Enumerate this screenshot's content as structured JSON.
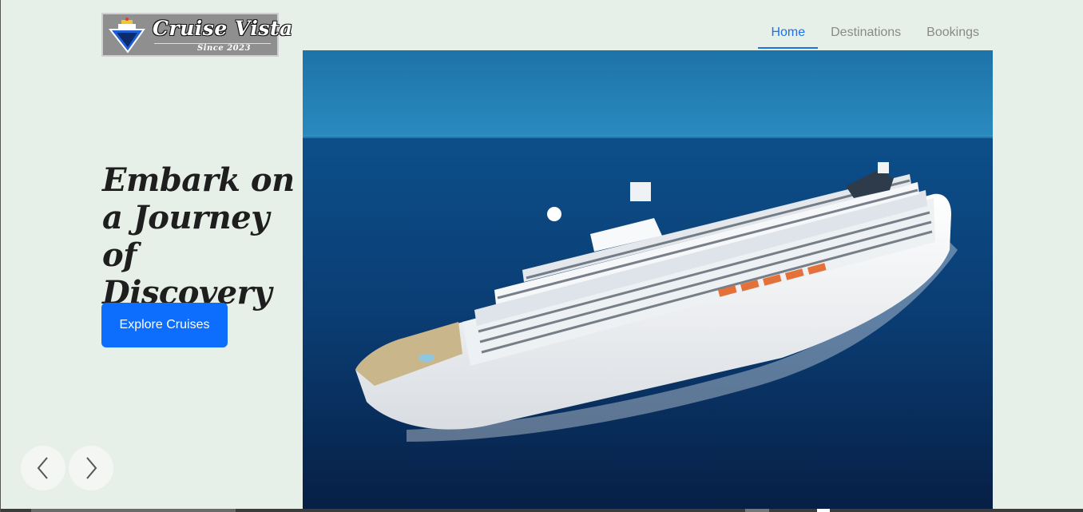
{
  "brand": {
    "name": "Cruise Vista",
    "tagline": "Since 2023"
  },
  "nav": {
    "items": [
      {
        "label": "Home",
        "active": true
      },
      {
        "label": "Destinations",
        "active": false
      },
      {
        "label": "Bookings",
        "active": false
      }
    ]
  },
  "hero": {
    "title": "Embark on a Journey of Discovery",
    "cta_label": "Explore Cruises",
    "image_subject": "cruise ship at sea"
  },
  "carousel": {
    "prev_icon": "chevron-left-icon",
    "next_icon": "chevron-right-icon"
  },
  "colors": {
    "accent": "#0d6efd",
    "nav_active": "#1a73e8",
    "background": "#e6efe8"
  }
}
